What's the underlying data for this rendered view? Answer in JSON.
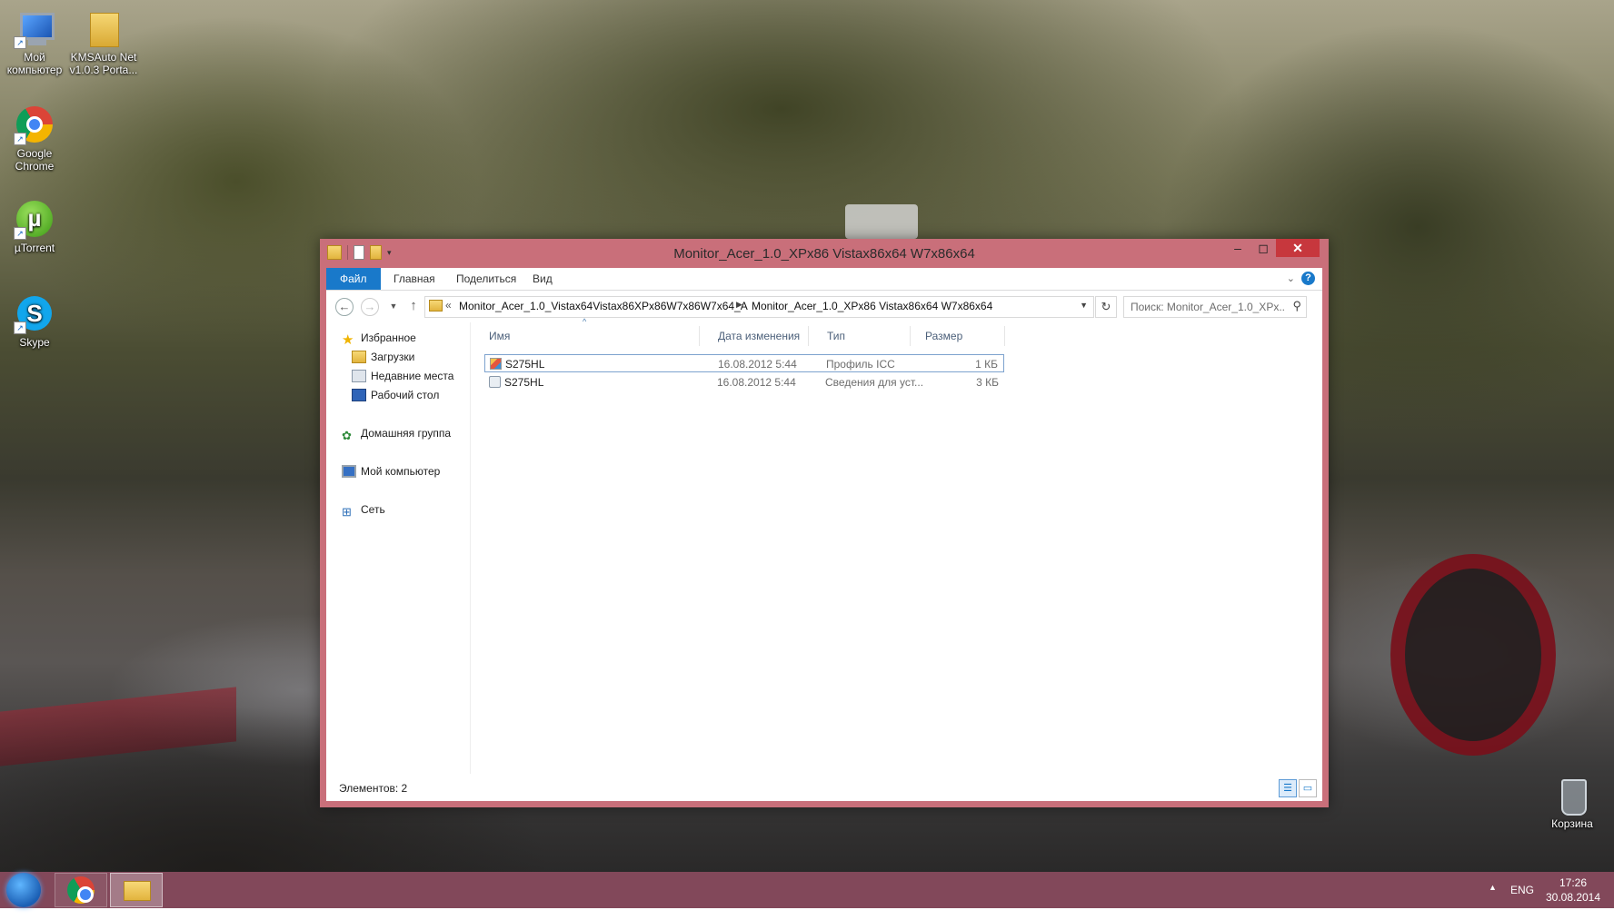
{
  "desktop": {
    "icons": [
      {
        "label": "Мой компьютер",
        "icon": "computer-icon"
      },
      {
        "label": "KMSAuto Net v1.0.3 Porta...",
        "icon": "folder-icon"
      },
      {
        "label": "Google Chrome",
        "icon": "chrome-icon"
      },
      {
        "label": "µTorrent",
        "icon": "utorrent-icon"
      },
      {
        "label": "Skype",
        "icon": "skype-icon"
      },
      {
        "label": "Корзина",
        "icon": "recycle-bin-icon"
      }
    ]
  },
  "window": {
    "title": "Monitor_Acer_1.0_XPx86 Vistax86x64 W7x86x64",
    "ribbon": {
      "tabs": [
        "Файл",
        "Главная",
        "Поделиться",
        "Вид"
      ],
      "help": "?"
    },
    "address": {
      "overflow": "«",
      "crumbs": [
        "Monitor_Acer_1.0_Vistax64Vistax86XPx86W7x86W7x64_A",
        "Monitor_Acer_1.0_XPx86 Vistax86x64 W7x86x64"
      ]
    },
    "search": {
      "placeholder": "Поиск: Monitor_Acer_1.0_XPx..."
    },
    "nav_pane": {
      "favorites": "Избранное",
      "favorites_items": [
        "Загрузки",
        "Недавние места",
        "Рабочий стол"
      ],
      "homegroup": "Домашняя группа",
      "computer": "Мой компьютер",
      "network": "Сеть"
    },
    "columns": {
      "name": "Имя",
      "date": "Дата изменения",
      "type": "Тип",
      "size": "Размер"
    },
    "files": [
      {
        "name": "S275HL",
        "date": "16.08.2012 5:44",
        "type": "Профиль ICC",
        "size": "1 КБ",
        "selected": true
      },
      {
        "name": "S275HL",
        "date": "16.08.2012 5:44",
        "type": "Сведения для уст...",
        "size": "3 КБ",
        "selected": false
      }
    ],
    "status": {
      "count": "Элементов: 2"
    }
  },
  "taskbar": {
    "apps": [
      "chrome-icon",
      "file-explorer-icon"
    ],
    "tray": {
      "language": "ENG",
      "time": "17:26",
      "date": "30.08.2014"
    }
  },
  "colors": {
    "window_frame": "#c96f7a",
    "taskbar": "#82485a",
    "accent": "#1979ca",
    "close": "#c7373d"
  }
}
